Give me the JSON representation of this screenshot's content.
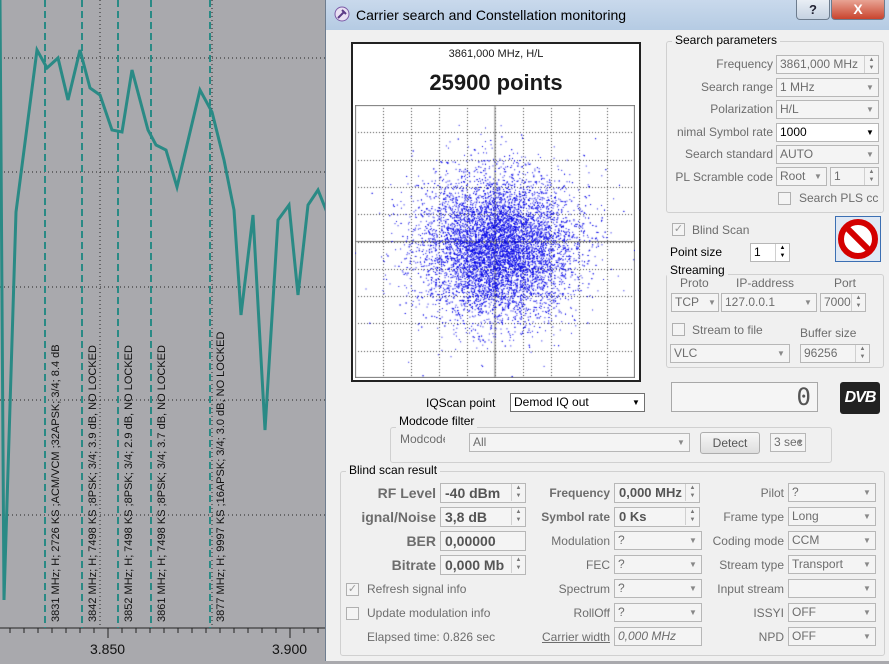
{
  "background": {
    "markers": [
      {
        "label": "3831 MHz; H; 2726 KS ;ACM/VCM ;32APSK; 3/4; 8.4 dB"
      },
      {
        "label": "3842 MHz; H; 7498 KS ;8PSK; 3/4; 3.9 dB, NO LOCKED"
      },
      {
        "label": "3852 MHz; H; 7498 KS ;8PSK; 3/4; 2.9 dB, NO LOCKED"
      },
      {
        "label": "3861 MHz; H; 7498 KS ;8PSK; 3/4; 3.7 dB, NO LOCKED"
      },
      {
        "label": "3877 MHz; H; 9997 KS ;16APSK; 3/4; 3.0 dB, NO LOCKED"
      }
    ],
    "x_ticks": [
      "3.850",
      "3.900"
    ],
    "colors": {
      "trace": "#2a8a85",
      "marker": "#2a8a85",
      "grid": "#222222"
    }
  },
  "window": {
    "title": "Carrier search and Constellation monitoring",
    "help_label": "?",
    "close_label": "X"
  },
  "plot": {
    "frequency_label": "3861,000 MHz, H/L",
    "points_label": "25900 points",
    "point_color": "#0000e6"
  },
  "search_parameters": {
    "title": "Search parameters",
    "frequency_label": "Frequency",
    "frequency_value": "3861,000 MHz",
    "range_label": "Search range",
    "range_value": "1 MHz",
    "polarization_label": "Polarization",
    "polarization_value": "H/L",
    "symbol_rate_label": "nimal Symbol rate",
    "symbol_rate_value": "1000",
    "standard_label": "Search standard",
    "standard_value": "AUTO",
    "scramble_label": "PL Scramble code",
    "scramble_mode": "Root",
    "scramble_value": "1",
    "search_pls_label": "Search PLS cc"
  },
  "blind_scan_label": "Blind Scan",
  "point_size_label": "Point size",
  "point_size_value": "1",
  "streaming": {
    "title": "Streaming",
    "proto_label": "Proto",
    "ip_label": "IP-address",
    "port_label": "Port",
    "proto_value": "TCP",
    "ip_value": "127.0.0.1",
    "port_value": "7000",
    "stream_to_file_label": "Stream to file",
    "buffer_label": "Buffer size",
    "player_value": "VLC",
    "buffer_value": "96256"
  },
  "counter_value": "0",
  "dvb_logo": "DVB",
  "iqscan": {
    "label": "IQScan point",
    "value": "Demod IQ out"
  },
  "modcode": {
    "title": "Modcode filter",
    "label": "Modcode",
    "value": "All",
    "detect_label": "Detect",
    "time_value": "3 sec"
  },
  "result": {
    "title": "Blind scan result",
    "rf_label": "RF Level",
    "rf_value": "-40 dBm",
    "sn_label": "ignal/Noise",
    "sn_value": "3,8 dB",
    "ber_label": "BER",
    "ber_value": "0,00000",
    "bitrate_label": "Bitrate",
    "bitrate_value": "0,000 Mb",
    "freq_label": "Frequency",
    "freq_value": "0,000 MHz",
    "sr_label": "Symbol rate",
    "sr_value": "0 Ks",
    "mod_label": "Modulation",
    "mod_value": "?",
    "fec_label": "FEC",
    "fec_value": "?",
    "spectrum_label": "Spectrum",
    "spectrum_value": "?",
    "rolloff_label": "RollOff",
    "rolloff_value": "?",
    "carrier_width_label": "Carrier width",
    "carrier_width_value": "0,000 MHz",
    "pilot_label": "Pilot",
    "pilot_value": "?",
    "frame_label": "Frame type",
    "frame_value": "Long",
    "coding_label": "Coding mode",
    "coding_value": "CCM",
    "stream_type_label": "Stream type",
    "stream_type_value": "Transport",
    "input_stream_label": "Input stream",
    "input_stream_value": "",
    "issyi_label": "ISSYI",
    "issyi_value": "OFF",
    "npd_label": "NPD",
    "npd_value": "OFF",
    "refresh_label": "Refresh signal info",
    "update_label": "Update modulation info",
    "elapsed_label": "Elapsed time: 0.826 sec"
  }
}
